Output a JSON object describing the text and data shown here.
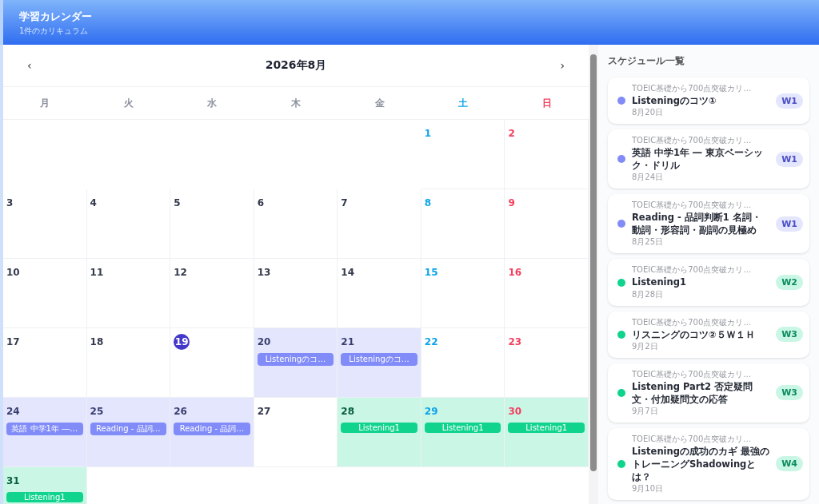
{
  "header": {
    "title": "学習カレンダー",
    "subtitle": "1件のカリキュラム"
  },
  "calendar": {
    "prev": "‹",
    "month": "2026年8月",
    "next": "›",
    "weekdays": [
      {
        "label": "月",
        "kind": "weekday"
      },
      {
        "label": "火",
        "kind": "weekday"
      },
      {
        "label": "水",
        "kind": "weekday"
      },
      {
        "label": "木",
        "kind": "weekday"
      },
      {
        "label": "金",
        "kind": "weekday"
      },
      {
        "label": "土",
        "kind": "sat"
      },
      {
        "label": "日",
        "kind": "sun"
      }
    ],
    "weeks": [
      [
        {
          "kind": "blank"
        },
        {
          "kind": "blank"
        },
        {
          "kind": "blank"
        },
        {
          "kind": "blank"
        },
        {
          "kind": "blank"
        },
        {
          "day": "1",
          "kind": "sat"
        },
        {
          "day": "2",
          "kind": "sun"
        }
      ],
      [
        {
          "day": "3",
          "kind": "weekday"
        },
        {
          "day": "4",
          "kind": "weekday"
        },
        {
          "day": "5",
          "kind": "weekday"
        },
        {
          "day": "6",
          "kind": "weekday"
        },
        {
          "day": "7",
          "kind": "weekday"
        },
        {
          "day": "8",
          "kind": "sat"
        },
        {
          "day": "9",
          "kind": "sun"
        }
      ],
      [
        {
          "day": "10",
          "kind": "weekday"
        },
        {
          "day": "11",
          "kind": "weekday"
        },
        {
          "day": "12",
          "kind": "weekday"
        },
        {
          "day": "13",
          "kind": "weekday"
        },
        {
          "day": "14",
          "kind": "weekday"
        },
        {
          "day": "15",
          "kind": "sat"
        },
        {
          "day": "16",
          "kind": "sun"
        }
      ],
      [
        {
          "day": "17",
          "kind": "weekday"
        },
        {
          "day": "18",
          "kind": "weekday"
        },
        {
          "day": "19",
          "kind": "weekday",
          "today": true
        },
        {
          "day": "20",
          "kind": "weekday",
          "event": {
            "label": "Listeningのコ…",
            "color": "#818cf8"
          }
        },
        {
          "day": "21",
          "kind": "weekday",
          "event": {
            "label": "Listeningのコ…",
            "color": "#818cf8"
          }
        },
        {
          "day": "22",
          "kind": "sat"
        },
        {
          "day": "23",
          "kind": "sun"
        }
      ],
      [
        {
          "day": "24",
          "kind": "weekday",
          "event": {
            "label": "英語 中学1年 ―…",
            "color": "#818cf8"
          }
        },
        {
          "day": "25",
          "kind": "weekday",
          "event": {
            "label": "Reading - 品詞…",
            "color": "#818cf8"
          }
        },
        {
          "day": "26",
          "kind": "weekday",
          "event": {
            "label": "Reading - 品詞…",
            "color": "#818cf8"
          }
        },
        {
          "day": "27",
          "kind": "weekday"
        },
        {
          "day": "28",
          "kind": "weekday",
          "event": {
            "label": "Listening1",
            "color": "#10d48e"
          }
        },
        {
          "day": "29",
          "kind": "sat",
          "event": {
            "label": "Listening1",
            "color": "#10d48e"
          }
        },
        {
          "day": "30",
          "kind": "sun",
          "event": {
            "label": "Listening1",
            "color": "#10d48e"
          }
        }
      ],
      [
        {
          "day": "31",
          "kind": "weekday",
          "event": {
            "label": "Listening1",
            "color": "#10d48e"
          }
        },
        {
          "kind": "blank"
        },
        {
          "kind": "blank"
        },
        {
          "kind": "blank"
        },
        {
          "kind": "blank"
        },
        {
          "kind": "blank"
        },
        {
          "kind": "blank"
        }
      ]
    ]
  },
  "schedule": {
    "title": "スケジュール一覧",
    "items": [
      {
        "course": "TOEIC基礎から700点突破カリ…",
        "title": "Listeningのコツ①",
        "date": "8月20日",
        "week": "W1",
        "color": "#818cf8"
      },
      {
        "course": "TOEIC基礎から700点突破カリ…",
        "title": "英語 中学1年 ― 東京ベーシック・ドリル",
        "date": "8月24日",
        "week": "W1",
        "color": "#818cf8"
      },
      {
        "course": "TOEIC基礎から700点突破カリ…",
        "title": "Reading - 品詞判断1 名詞・動詞・形容詞・副詞の見極め",
        "date": "8月25日",
        "week": "W1",
        "color": "#818cf8"
      },
      {
        "course": "TOEIC基礎から700点突破カリ…",
        "title": "Listening1",
        "date": "8月28日",
        "week": "W2",
        "color": "#10d48e"
      },
      {
        "course": "TOEIC基礎から700点突破カリ…",
        "title": "リスニングのコツ②５Ｗ１Ｈ",
        "date": "9月2日",
        "week": "W3",
        "color": "#10d48e"
      },
      {
        "course": "TOEIC基礎から700点突破カリ…",
        "title": "Listening Part2 否定疑問文・付加疑問文の応答",
        "date": "9月7日",
        "week": "W3",
        "color": "#10d48e"
      },
      {
        "course": "TOEIC基礎から700点突破カリ…",
        "title": "Listeningの成功のカギ 最強のトレーニングShadowingとは？",
        "date": "9月10日",
        "week": "W4",
        "color": "#10d48e"
      }
    ]
  }
}
